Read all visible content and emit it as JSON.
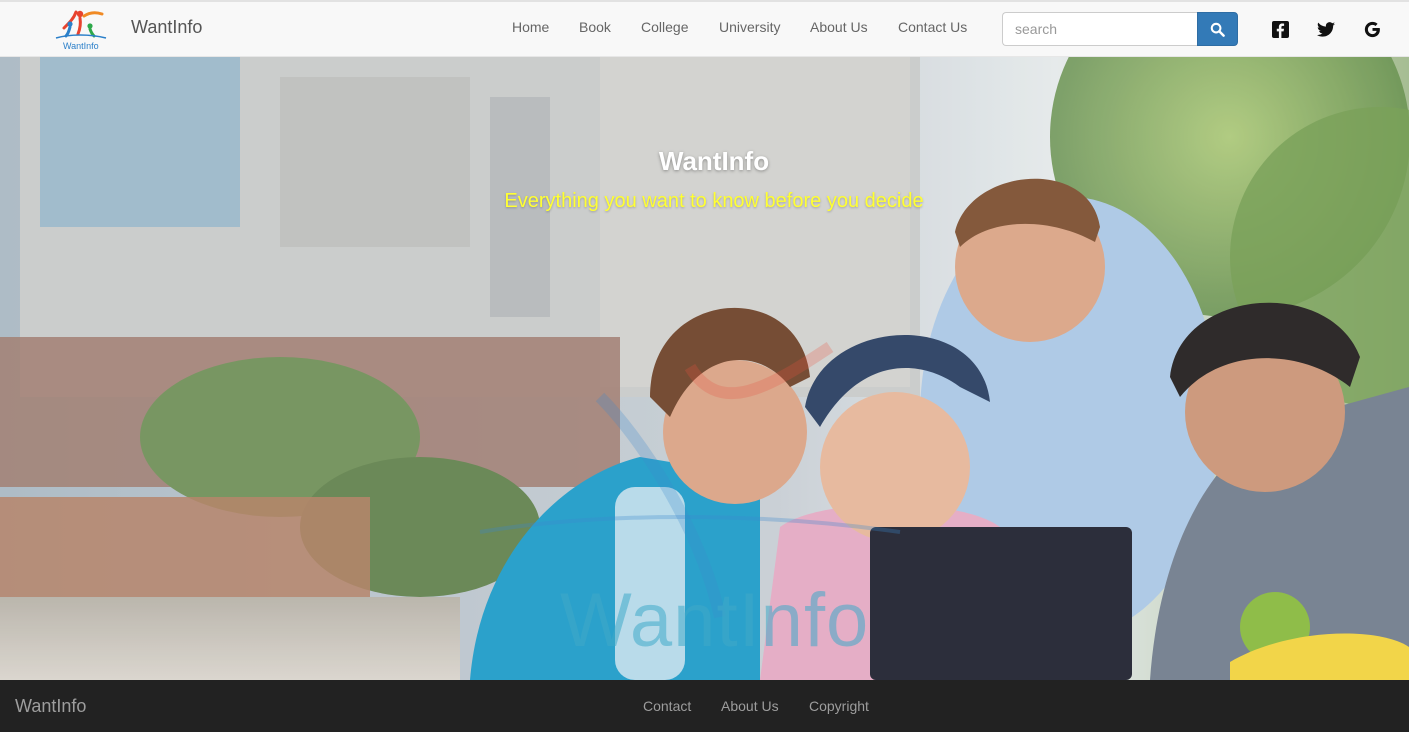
{
  "navbar": {
    "brand": "WantInfo",
    "logo_text": "WantInfo",
    "links": [
      "Home",
      "Book",
      "College",
      "University",
      "About Us",
      "Contact Us"
    ],
    "search": {
      "placeholder": "search",
      "value": ""
    },
    "search_icon": "search-icon",
    "social_icons": [
      "facebook-icon",
      "twitter-icon",
      "google-icon"
    ]
  },
  "hero": {
    "title": "WantInfo",
    "subtitle": "Everything you want to know before you decide",
    "watermark": "WantInfo"
  },
  "footer": {
    "brand": "WantInfo",
    "links": [
      "Contact",
      "About Us",
      "Copyright"
    ]
  },
  "colors": {
    "navbar_bg": "#f8f8f8",
    "footer_bg": "#222222",
    "search_button": "#337ab7",
    "subtitle": "#ffff33"
  }
}
